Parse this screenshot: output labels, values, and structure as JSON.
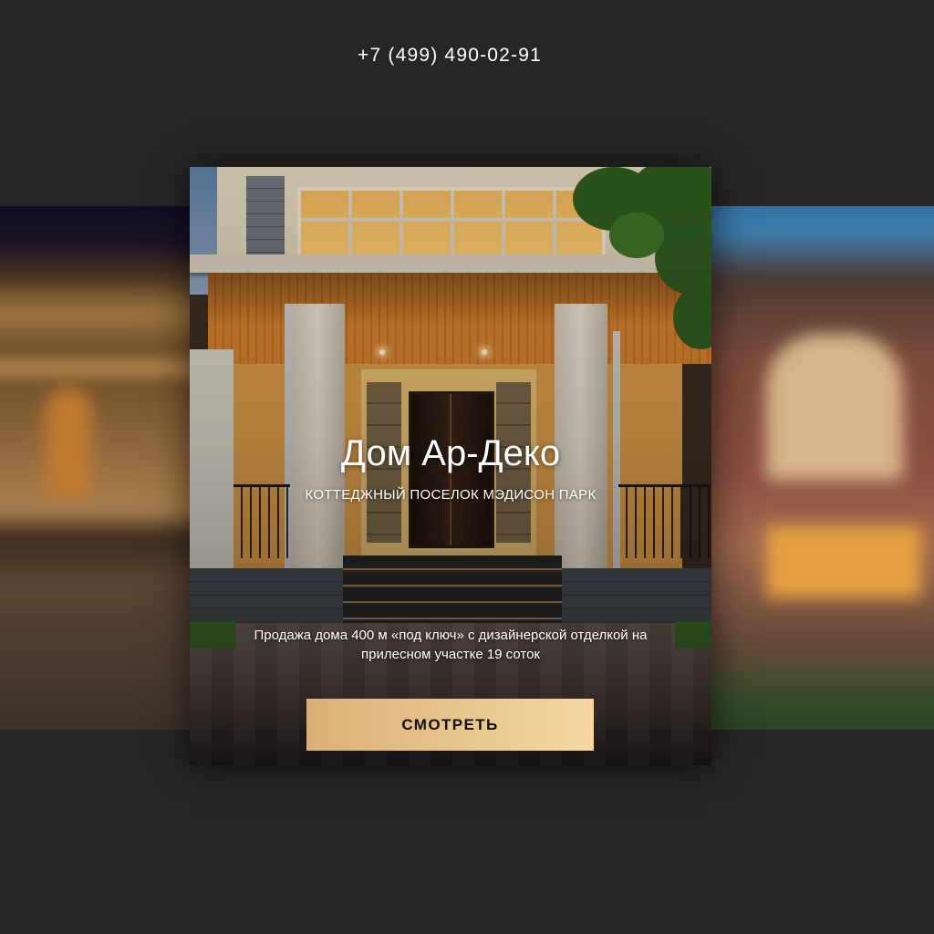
{
  "header": {
    "phone": "+7 (499) 490-02-91"
  },
  "slider": {
    "active_slide": {
      "title": "Дом Ар-Деко",
      "subtitle": "КОТТЕДЖНЫЙ ПОСЕЛОК МЭДИСОН ПАРК",
      "description": "Продажа дома 400 м «под ключ» с дизайнерской отделкой на прилесном участке 19 соток",
      "button_label": "СМОТРЕТЬ"
    }
  },
  "colors": {
    "background": "#262626",
    "button_gradient_start": "#d9b078",
    "button_gradient_end": "#f6d7a2",
    "text": "#ffffff",
    "button_text": "#111111"
  }
}
